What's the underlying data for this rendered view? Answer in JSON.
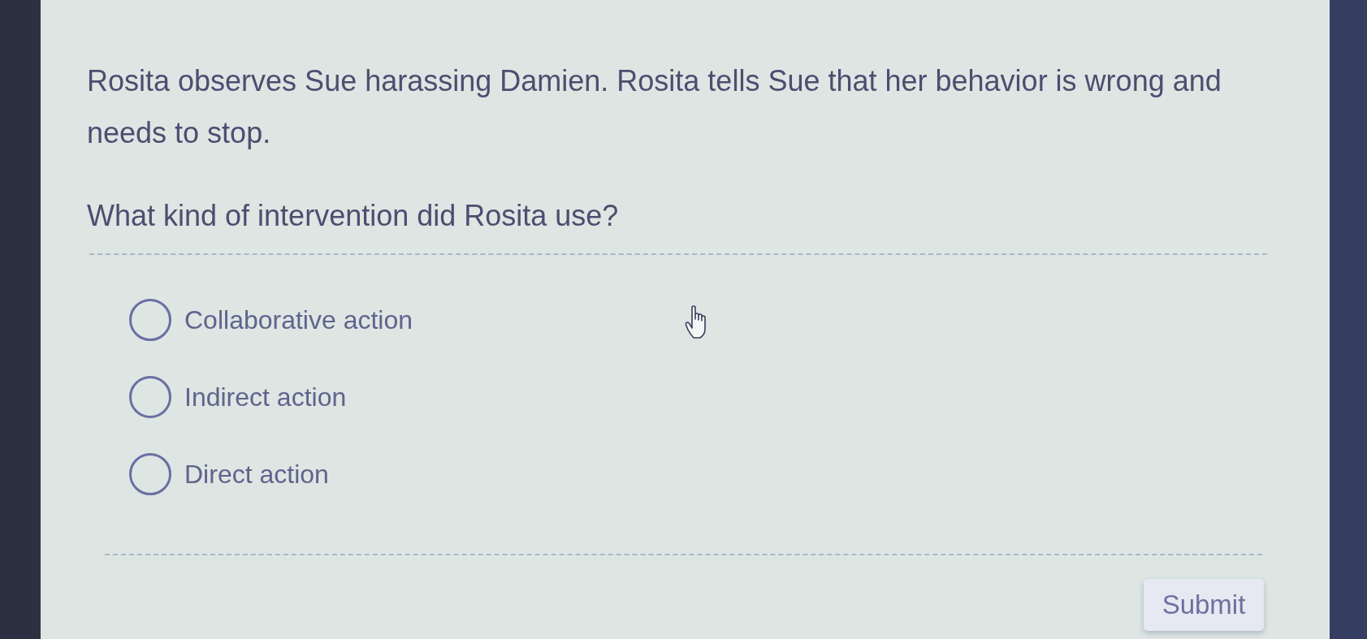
{
  "question": {
    "text": "Rosita observes Sue harassing Damien. Rosita tells Sue that her behavior is wrong and needs to stop.",
    "prompt": "What kind of intervention did Rosita use?"
  },
  "options": [
    {
      "label": "Collaborative action",
      "selected": false
    },
    {
      "label": "Indirect action",
      "selected": false
    },
    {
      "label": "Direct action",
      "selected": false
    }
  ],
  "submit_button": {
    "label": "Submit"
  }
}
